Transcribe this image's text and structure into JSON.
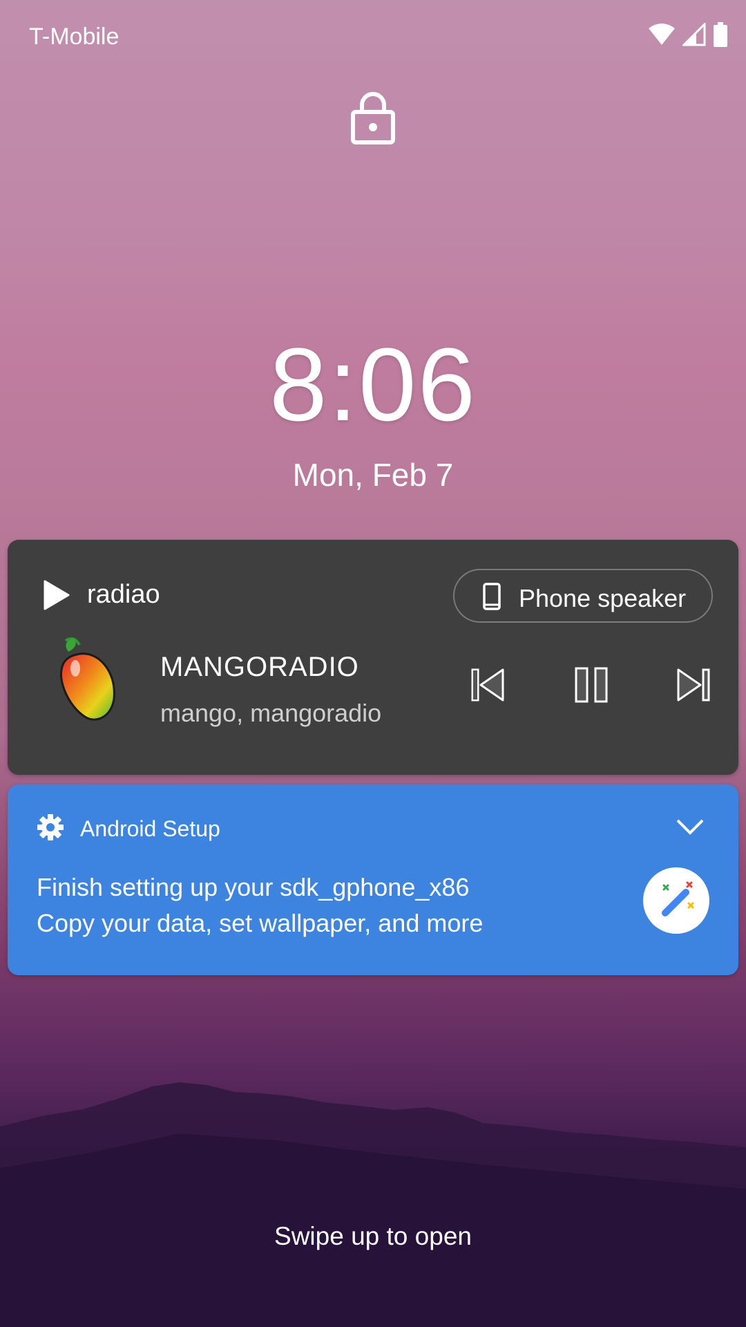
{
  "status_bar": {
    "carrier": "T-Mobile",
    "icons": [
      "wifi-icon",
      "cell-signal-icon",
      "battery-icon"
    ]
  },
  "lock_screen": {
    "lock_icon": "lock-icon",
    "time": "8:06",
    "date": "Mon, Feb 7",
    "swipe_hint": "Swipe up to open"
  },
  "media_notification": {
    "app_name": "radiao",
    "output_device": "Phone speaker",
    "track_title": "MANGORADIO",
    "track_artist": "mango, mangoradio",
    "controls": [
      "skip-previous-icon",
      "pause-icon",
      "skip-next-icon"
    ],
    "background": "#3f3f3f"
  },
  "setup_notification": {
    "app_name": "Android Setup",
    "title": "Finish setting up your sdk_gphone_x86",
    "text": "Copy your data, set wallpaper, and more",
    "background": "#3c84e0"
  }
}
